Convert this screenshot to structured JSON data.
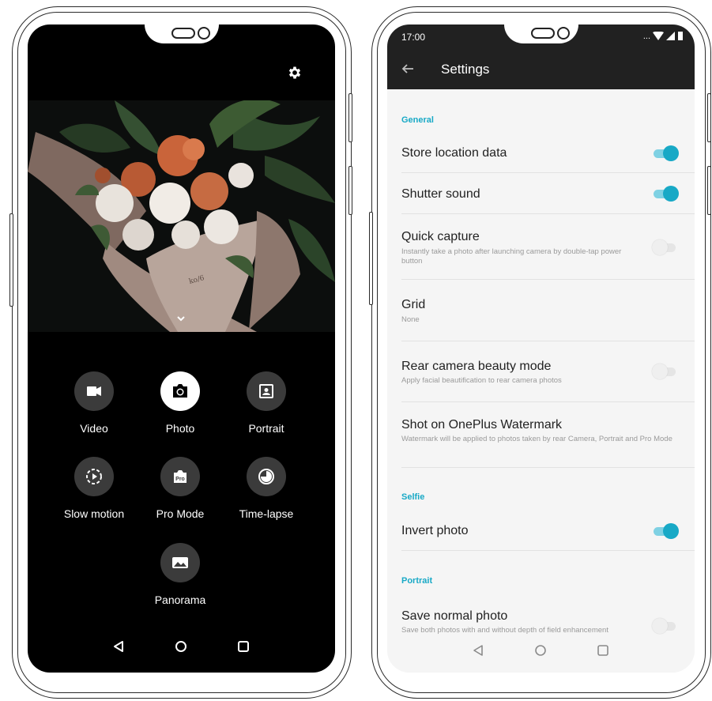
{
  "camera_screen": {
    "modes": [
      {
        "label": "Video",
        "icon": "video-icon",
        "active": false
      },
      {
        "label": "Photo",
        "icon": "camera-icon",
        "active": true
      },
      {
        "label": "Portrait",
        "icon": "portrait-icon",
        "active": false
      },
      {
        "label": "Slow motion",
        "icon": "slow-motion-icon",
        "active": false
      },
      {
        "label": "Pro Mode",
        "icon": "pro-mode-icon",
        "active": false,
        "badge": "Pro"
      },
      {
        "label": "Time-lapse",
        "icon": "time-lapse-icon",
        "active": false
      },
      {
        "label": "Panorama",
        "icon": "panorama-icon",
        "active": false
      }
    ],
    "top_icon": "gear-icon",
    "collapse_icon": "chevron-down-icon"
  },
  "settings_screen": {
    "status_time": "17:00",
    "status_more": "...",
    "title": "Settings",
    "sections": {
      "general": "General",
      "selfie": "Selfie",
      "portrait": "Portrait"
    },
    "rows": {
      "store_location": {
        "title": "Store location data",
        "enabled": true
      },
      "shutter_sound": {
        "title": "Shutter sound",
        "enabled": true
      },
      "quick_capture": {
        "title": "Quick capture",
        "subtitle": "Instantly take a photo after launching camera by double-tap power button",
        "enabled": false
      },
      "grid": {
        "title": "Grid",
        "subtitle": "None"
      },
      "rear_beauty": {
        "title": "Rear camera beauty mode",
        "subtitle": "Apply facial beautification to rear camera photos",
        "enabled": false
      },
      "watermark": {
        "title": "Shot on OnePlus Watermark",
        "subtitle": "Watermark will be applied to photos taken by rear Camera, Portrait and Pro Mode"
      },
      "invert_photo": {
        "title": "Invert photo",
        "enabled": true
      },
      "save_normal": {
        "title": "Save normal photo",
        "subtitle": "Save both photos with and without depth of field enhancement",
        "enabled": false
      }
    }
  },
  "colors": {
    "accent": "#18a9c6",
    "appbar": "#212121",
    "camera_bg": "#000000"
  }
}
